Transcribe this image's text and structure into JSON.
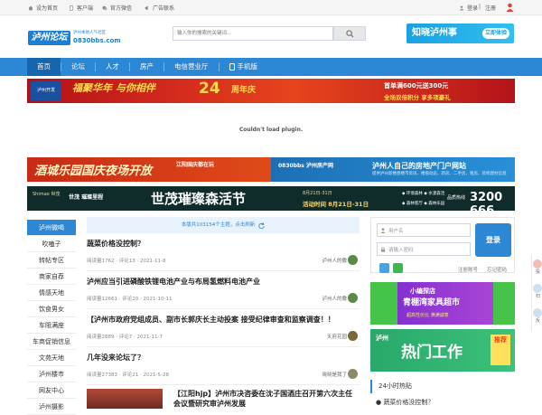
{
  "topbar": {
    "set_home": "设为首页",
    "client": "客户端",
    "wechat": "官方微信",
    "ad_contact": "广告联系",
    "login": "登录",
    "divider": "|",
    "register": "注册"
  },
  "header": {
    "logo_text": "泸州论坛",
    "logo_tagline": "泸州本地人气社区",
    "logo_url": "0830bbs.com",
    "search_placeholder": "输入你的搜索的关键词...",
    "ad_text": "知晓泸州事",
    "ad_cta": "立即体验"
  },
  "nav": {
    "items": [
      {
        "label": "首页",
        "active": true
      },
      {
        "label": "论坛",
        "active": false
      },
      {
        "label": "人才",
        "active": false
      },
      {
        "label": "房产",
        "active": false
      },
      {
        "label": "电信营业厅",
        "active": false
      }
    ],
    "mobile_label": "手机版"
  },
  "banner1": {
    "logo": "泸州开发",
    "slogan": "福聚华年 与你相伴",
    "anniv_num": "24",
    "anniv_text": "周年庆",
    "promo1": "首单满600元送300元",
    "promo2": "全场双倍积分 享多项豪礼"
  },
  "plugin_message": "Couldn't load plugin.",
  "banner2": {
    "left_text": "酒城乐园国庆夜场开放",
    "left_sub": "江阳国庆都在玩",
    "right_logo": "0830bbs 泸州房产网",
    "right_title": "泸州人自己的房地产门户网站",
    "right_sub": "提供泸州新楼盘楼市资讯、楼盘动态、新房、二手房、租房、装修建材信息"
  },
  "banner3": {
    "brand": "Shimao 世茂",
    "project": "世茂 璀璨里程",
    "headline": "世茂璀璨森活节",
    "event_line1": "8月21日-31日",
    "event_line2": "活动时间 8月21日-31日",
    "tag1": "◆ 环境森林  ◆ 水漾森活",
    "tag2": "◆ 森林客厅  ◆ 森林乐园",
    "phone_label": "品质热线",
    "phone": "3200 666"
  },
  "sidebar": {
    "items": [
      {
        "label": "泸州微喝",
        "active": true
      },
      {
        "label": "吹嗑子",
        "active": false
      },
      {
        "label": "转帖专区",
        "active": false
      },
      {
        "label": "商家自荐",
        "active": false
      },
      {
        "label": "情感天地",
        "active": false
      },
      {
        "label": "饮食男女",
        "active": false
      },
      {
        "label": "车阻满座",
        "active": false
      },
      {
        "label": "车商促销信息",
        "active": false
      },
      {
        "label": "文苑天地",
        "active": false
      },
      {
        "label": "泸州楼市",
        "active": false
      },
      {
        "label": "网友中心",
        "active": false
      },
      {
        "label": "泸州摄影",
        "active": false
      }
    ]
  },
  "feed": {
    "banner": "本版共103154个主题，点击刷新",
    "posts": [
      {
        "title": "蔬菜价格没控制？",
        "meta": "阅读量1762 · 评论13 · 2021-11-8",
        "author": "泸州人的撒"
      },
      {
        "title": "泸州应当引进磷酸铁锂电池产业与布局氢燃料电池产业",
        "meta": "阅读量12661 · 评论20 · 2021-10-11",
        "author": "泸州人的撒"
      },
      {
        "title": "【泸州市政府党组成员、副市长郭庆长主动投案 接受纪律审查和监察调查！！",
        "meta": "阅读量2889 · 评论7 · 2021-11-7",
        "author": "天府花园"
      },
      {
        "title": "几年没来论坛了？",
        "meta": "阅读量27383 · 评论21 · 2021-5-28",
        "author": "晓晓是我了"
      },
      {
        "title": "【江阳hjp】泸州市决咨委在沈子国酒庄召开第六次主任会议暨研究审泸州发展",
        "meta": "",
        "author": ""
      }
    ]
  },
  "login_box": {
    "username_placeholder": "用户名",
    "password_placeholder": "请输入密码",
    "login_button": "登录",
    "register_link": "注册账号",
    "forgot_link": "忘记密码"
  },
  "ad_right1": {
    "line1": "小编探店",
    "line2": "青棚湾家具超市",
    "line3": "超高性价比 满满诚意"
  },
  "ad_right2": {
    "small": "泸州",
    "big": "热门工作",
    "side": "推荐"
  },
  "hot": {
    "title": "24小时热贴",
    "items": [
      "● 蔬菜价格没控制？"
    ]
  },
  "right_rail": [
    "投",
    "扫",
    "反"
  ],
  "colors": {
    "primary": "#2c87d4",
    "nav_active": "#1566ad",
    "feed_banner_bg": "#e8f2fc"
  }
}
